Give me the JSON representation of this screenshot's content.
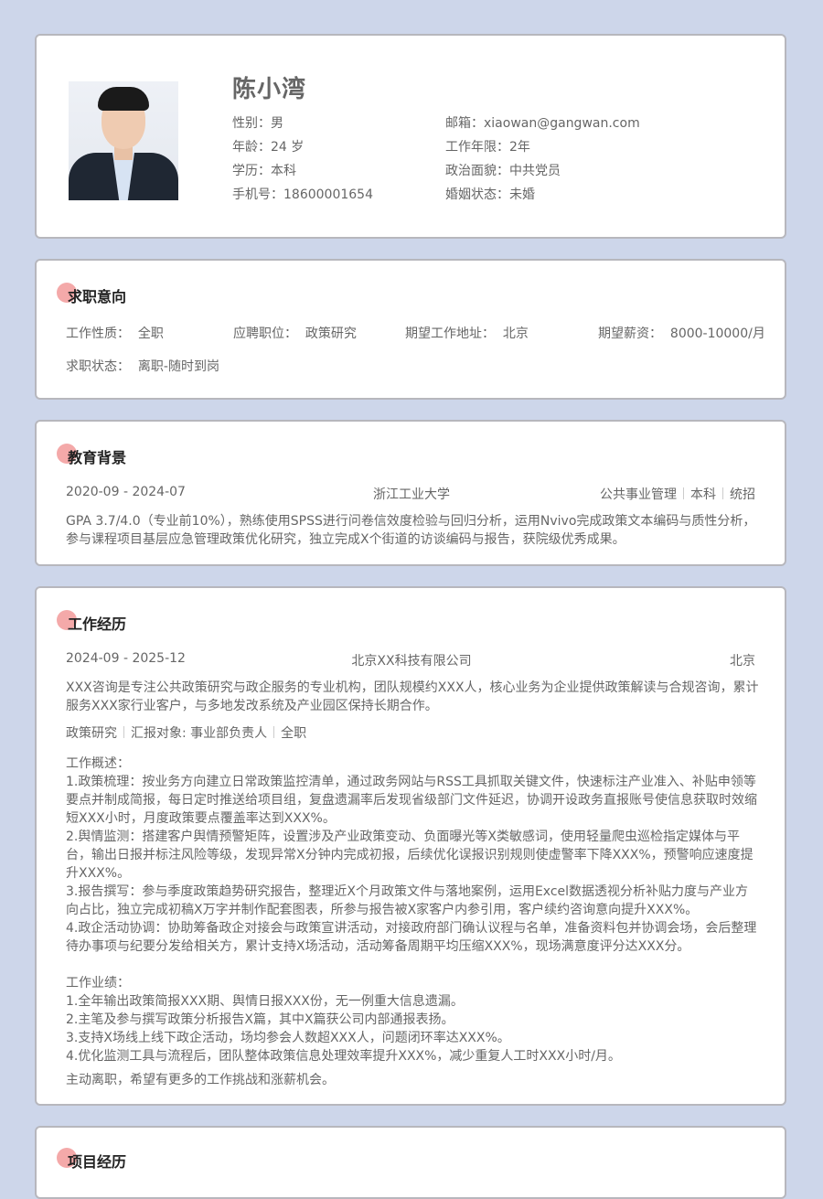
{
  "profile": {
    "name": "陈小湾",
    "left_fields": [
      {
        "label": "性别：",
        "value": "男"
      },
      {
        "label": "年龄：",
        "value": "24 岁"
      },
      {
        "label": "学历：",
        "value": "本科"
      },
      {
        "label": "手机号：",
        "value": "18600001654"
      }
    ],
    "right_fields": [
      {
        "label": "邮箱：",
        "value": "xiaowan@gangwan.com"
      },
      {
        "label": "工作年限：",
        "value": "2年"
      },
      {
        "label": "政治面貌：",
        "value": "中共党员"
      },
      {
        "label": "婚姻状态：",
        "value": "未婚"
      }
    ]
  },
  "intent": {
    "title": "求职意向",
    "fields": [
      {
        "label": "工作性质：",
        "value": "全职"
      },
      {
        "label": "应聘职位：",
        "value": "政策研究"
      },
      {
        "label": "期望工作地址：",
        "value": "北京"
      },
      {
        "label": "期望薪资：",
        "value": "8000-10000/月"
      },
      {
        "label": "求职状态：",
        "value": "离职-随时到岗"
      }
    ]
  },
  "education": {
    "title": "教育背景",
    "date": "2020-09 - 2024-07",
    "school": "浙江工业大学",
    "tags": [
      "公共事业管理",
      "本科",
      "统招"
    ],
    "desc": "GPA 3.7/4.0（专业前10%），熟练使用SPSS进行问卷信效度检验与回归分析，运用Nvivo完成政策文本编码与质性分析，参与课程项目基层应急管理政策优化研究，独立完成X个街道的访谈编码与报告，获院级优秀成果。"
  },
  "work": {
    "title": "工作经历",
    "date": "2024-09 - 2025-12",
    "company": "北京XX科技有限公司",
    "city": "北京",
    "intro": "XXX咨询是专注公共政策研究与政企服务的专业机构，团队规模约XXX人，核心业务为企业提供政策解读与合规咨询，累计服务XXX家行业客户，与多地发改系统及产业园区保持长期合作。",
    "tags": [
      "政策研究",
      "汇报对象: 事业部负责人",
      "全职"
    ],
    "overview_title": "工作概述：",
    "overview": [
      "1.政策梳理：按业务方向建立日常政策监控清单，通过政务网站与RSS工具抓取关键文件，快速标注产业准入、补贴申领等要点并制成简报，每日定时推送给项目组，复盘遗漏率后发现省级部门文件延迟，协调开设政务直报账号使信息获取时效缩短XXX小时，月度政策要点覆盖率达到XXX%。",
      "2.舆情监测：搭建客户舆情预警矩阵，设置涉及产业政策变动、负面曝光等X类敏感词，使用轻量爬虫巡检指定媒体与平台，输出日报并标注风险等级，发现异常X分钟内完成初报，后续优化误报识别规则使虚警率下降XXX%，预警响应速度提升XXX%。",
      "3.报告撰写：参与季度政策趋势研究报告，整理近X个月政策文件与落地案例，运用Excel数据透视分析补贴力度与产业方向占比，独立完成初稿X万字并制作配套图表，所参与报告被X家客户内参引用，客户续约咨询意向提升XXX%。",
      "4.政企活动协调：协助筹备政企对接会与政策宣讲活动，对接政府部门确认议程与名单，准备资料包并协调会场，会后整理待办事项与纪要分发给相关方，累计支持X场活动，活动筹备周期平均压缩XXX%，现场满意度评分达XXX分。"
    ],
    "achievements_title": "工作业绩：",
    "achievements": [
      "1.全年输出政策简报XXX期、舆情日报XXX份，无一例重大信息遗漏。",
      "2.主笔及参与撰写政策分析报告X篇，其中X篇获公司内部通报表扬。",
      "3.支持X场线上线下政企活动，场均参会人数超XXX人，问题闭环率达XXX%。",
      "4.优化监测工具与流程后，团队整体政策信息处理效率提升XXX%，减少重复人工时XXX小时/月。"
    ],
    "leave_reason": "主动离职，希望有更多的工作挑战和涨薪机会。"
  },
  "project": {
    "title": "项目经历"
  }
}
